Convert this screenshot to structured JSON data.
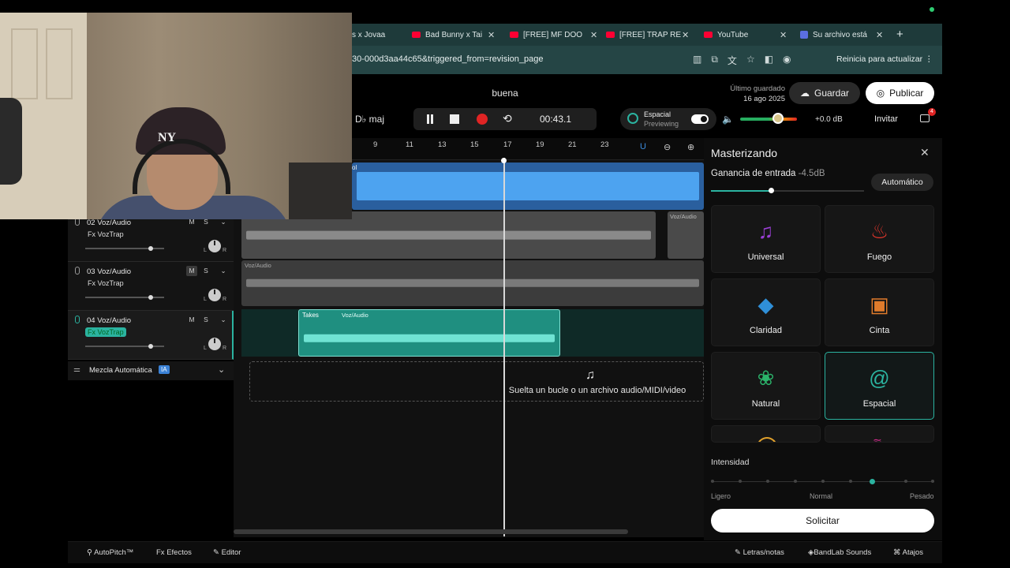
{
  "browser": {
    "tabs": [
      {
        "label": "s x Jovaa",
        "icon": "none"
      },
      {
        "label": "Bad Bunny x Tai",
        "icon": "youtube-icon"
      },
      {
        "label": "[FREE] MF DOO",
        "icon": "youtube-icon"
      },
      {
        "label": "[FREE] TRAP RE",
        "icon": "youtube-icon"
      },
      {
        "label": "YouTube",
        "icon": "youtube-icon"
      },
      {
        "label": "Su archivo está",
        "icon": "bandlab-icon"
      }
    ],
    "url": "30-000d3aa44c65&triggered_from=revision_page",
    "update_label": "Reinicia para actualizar"
  },
  "header": {
    "project_title": "buena",
    "last_saved_label": "Último guardado",
    "last_saved_date": "16 ago 2025",
    "save_label": "Guardar",
    "publish_label": "Publicar"
  },
  "transport": {
    "key": "D♭ maj",
    "time": "00:43.1",
    "spatial_label": "Espacial",
    "spatial_status": "Previewing",
    "gain_db": "+0.0 dB",
    "invite_label": "Invitar",
    "notification_count": "4",
    "volume_level": 0.66
  },
  "ruler": {
    "ticks": [
      "9",
      "11",
      "13",
      "15",
      "17",
      "19",
      "21",
      "23"
    ]
  },
  "tracks": [
    {
      "name": "02  Voz/Audio",
      "fx": "Fx VozTrap",
      "m": "M",
      "s": "S",
      "fader": 0.85,
      "active": false
    },
    {
      "name": "03  Voz/Audio",
      "fx": "Fx VozTrap",
      "m": "M",
      "s": "S",
      "fader": 0.85,
      "active": false
    },
    {
      "name": "04  Voz/Audio",
      "fx": "Fx VozTrap",
      "m": "M",
      "s": "S",
      "fader": 0.85,
      "active": true
    }
  ],
  "regions": {
    "label_voz": "Voz/Audio",
    "label_takes": "Takes",
    "label_track1": "ol"
  },
  "automix": {
    "label": "Mezcla Automática",
    "badge": "IA"
  },
  "drop_zone": {
    "text": "Suelta un bucle o un archivo audio/MIDI/video"
  },
  "mastering": {
    "title": "Masterizando",
    "gain_label": "Ganancia de entrada",
    "gain_value": "-4.5dB",
    "gain_level": 0.39,
    "auto_label": "Automático",
    "presets": [
      {
        "label": "Universal",
        "icon": "music-notes-icon",
        "color": "#9b3fd6"
      },
      {
        "label": "Fuego",
        "icon": "flame-icon",
        "color": "#e0352b"
      },
      {
        "label": "Claridad",
        "icon": "diamond-icon",
        "color": "#2f8fd8"
      },
      {
        "label": "Cinta",
        "icon": "cassette-icon",
        "color": "#e07b2b"
      },
      {
        "label": "Natural",
        "icon": "lotus-icon",
        "color": "#2bb36a"
      },
      {
        "label": "Espacial",
        "icon": "spiral-icon",
        "color": "#2bb3a0"
      }
    ],
    "selected_preset": "Espacial",
    "intensity_label": "Intensidad",
    "intensity_labels": [
      "Ligero",
      "Normal",
      "Pesado"
    ],
    "intensity_value": 0.72,
    "apply_label": "Solicitar"
  },
  "bottombar": {
    "autopitch": "AutoPitch™",
    "effects": "Efectos",
    "editor": "Editor",
    "lyrics": "Letras/notas",
    "sounds": "BandLab Sounds",
    "shortcuts": "Atajos"
  },
  "colors": {
    "accent": "#2bb3a0",
    "waveform_blue": "#3d8ee0",
    "waveform_teal": "#2bb3a0"
  }
}
